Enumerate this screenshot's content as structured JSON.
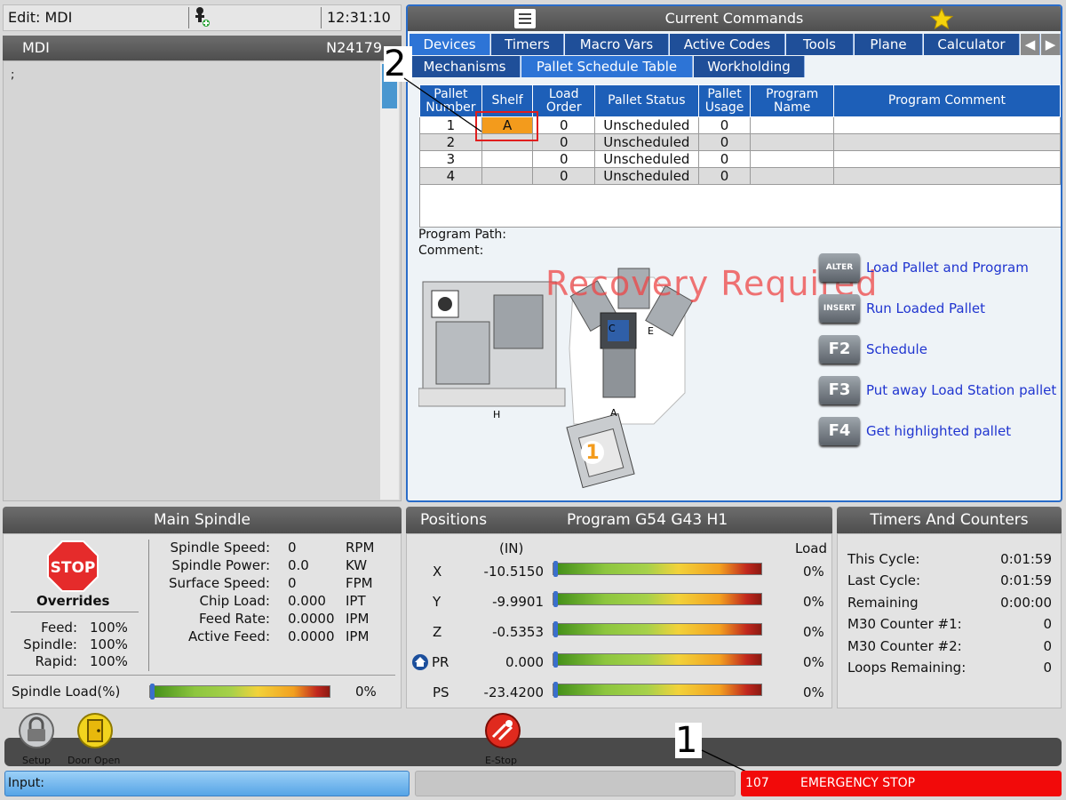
{
  "top": {
    "edit_mode": "Edit: MDI",
    "clock": "12:31:10"
  },
  "mdi": {
    "title": "MDI",
    "line_number": "N24179",
    "content": ";"
  },
  "current_commands": {
    "title": "Current Commands",
    "tabs_row1": [
      "Devices",
      "Timers",
      "Macro Vars",
      "Active Codes",
      "Tools",
      "Plane",
      "Calculator"
    ],
    "tabs_row2": [
      "Mechanisms",
      "Pallet Schedule Table",
      "Workholding"
    ],
    "active_tab_row1": "Devices",
    "active_tab_row2": "Pallet Schedule Table",
    "table": {
      "headers": [
        [
          "Pallet",
          "Number"
        ],
        [
          "Shelf"
        ],
        [
          "Load",
          "Order"
        ],
        [
          "Pallet Status"
        ],
        [
          "Pallet",
          "Usage"
        ],
        [
          "Program",
          "Name"
        ],
        [
          "Program Comment"
        ]
      ],
      "rows": [
        [
          "1",
          "A",
          "0",
          "Unscheduled",
          "0",
          "",
          ""
        ],
        [
          "2",
          "",
          "0",
          "Unscheduled",
          "0",
          "",
          ""
        ],
        [
          "3",
          "",
          "0",
          "Unscheduled",
          "0",
          "",
          ""
        ],
        [
          "4",
          "",
          "0",
          "Unscheduled",
          "0",
          "",
          ""
        ]
      ]
    },
    "program_path_label": "Program Path:",
    "comment_label": "Comment:",
    "recovery_text": "Recovery Required",
    "diagram_labels": {
      "c": "C",
      "e": "E",
      "h": "H",
      "a": "A",
      "station": "1"
    },
    "keys": [
      {
        "key": "ALTER",
        "label": "Load Pallet and Program"
      },
      {
        "key": "INSERT",
        "label": "Run Loaded Pallet"
      },
      {
        "key": "F2",
        "label": "Schedule"
      },
      {
        "key": "F3",
        "label": "Put away Load Station pallet"
      },
      {
        "key": "F4",
        "label": "Get highlighted pallet"
      }
    ]
  },
  "spindle": {
    "title": "Main Spindle",
    "stop_label": "STOP",
    "overrides_label": "Overrides",
    "overrides": [
      {
        "name": "Feed:",
        "value": "100%"
      },
      {
        "name": "Spindle:",
        "value": "100%"
      },
      {
        "name": "Rapid:",
        "value": "100%"
      }
    ],
    "stats": [
      {
        "name": "Spindle Speed:",
        "value": "0",
        "unit": "RPM"
      },
      {
        "name": "Spindle Power:",
        "value": "0.0",
        "unit": "KW"
      },
      {
        "name": "Surface Speed:",
        "value": "0",
        "unit": "FPM"
      },
      {
        "name": "Chip Load:",
        "value": "0.000",
        "unit": "IPT"
      },
      {
        "name": "Feed Rate:",
        "value": "0.0000",
        "unit": "IPM"
      },
      {
        "name": "Active Feed:",
        "value": "0.0000",
        "unit": "IPM"
      }
    ],
    "load_label": "Spindle Load(%)",
    "load_value": "0%",
    "load_fraction": 0.0
  },
  "positions": {
    "title_left": "Positions",
    "title_right": "Program G54 G43 H1",
    "unit_label": "(IN)",
    "load_label": "Load",
    "axes": [
      {
        "axis": "X",
        "value": "-10.5150",
        "load": "0%"
      },
      {
        "axis": "Y",
        "value": "-9.9901",
        "load": "0%"
      },
      {
        "axis": "Z",
        "value": "-0.5353",
        "load": "0%"
      },
      {
        "axis": "PR",
        "value": "0.000",
        "load": "0%"
      },
      {
        "axis": "PS",
        "value": "-23.4200",
        "load": "0%"
      }
    ]
  },
  "timers": {
    "title": "Timers And Counters",
    "rows": [
      {
        "name": "This Cycle:",
        "value": "0:01:59"
      },
      {
        "name": "Last Cycle:",
        "value": "0:01:59"
      },
      {
        "name": "Remaining",
        "value": "0:00:00"
      },
      {
        "name": "M30 Counter #1:",
        "value": "0"
      },
      {
        "name": "M30 Counter #2:",
        "value": "0"
      },
      {
        "name": "Loops Remaining:",
        "value": "0"
      }
    ]
  },
  "toolbar": {
    "setup_label": "Setup",
    "door_label": "Door Open",
    "estop_label": "E-Stop"
  },
  "status": {
    "input_label": "Input:",
    "alarm_code": "107",
    "alarm_text": "EMERGENCY STOP"
  },
  "callouts": {
    "one": "1",
    "two": "2"
  }
}
